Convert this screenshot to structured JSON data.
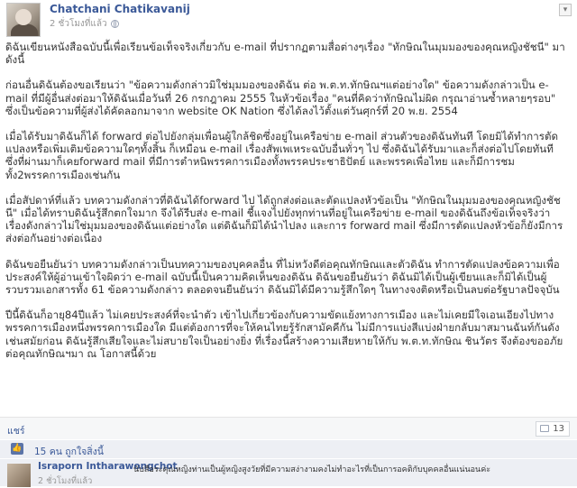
{
  "post": {
    "author": "Chatchani Chatikavanij",
    "time": "2 ชั่วโมงที่แล้ว",
    "paragraphs": [
      "ดิฉันเขียนหนังสือฉบับนี้เพื่อเรียนข้อเท็จจริงเกี่ยวกับ e-mail ที่ปรากฏตามสื่อต่างๆเรื่อง \"ทักษิณในมุมมองของคุณหญิงชัชนี\" มาดังนี้",
      "ก่อนอื่นดิฉันต้องขอเรียนว่า \"ข้อความดังกล่าวมิใช่มุมมองของดิฉัน ต่อ พ.ต.ท.ทักษิณฯแต่อย่างใด\" ข้อความดังกล่าวเป็น e-mail ที่มีผู้อื่นส่งต่อมาให้ดิฉันเมื่อวันที่ 26 กรกฎาคม 2555 ในหัวข้อเรื่อง \"คนที่คิดว่าทักษิณไม่ผิด กรุณาอ่านซ้ำหลายๆรอบ\" ซึ่งเป็นข้อความที่ผู้ส่งได้คัดลอกมาจาก website OK Nation ซึ่งได้ลงไว้ตั้งแต่วันศุกร์ที่ 20 พ.ย. 2554",
      "เมื่อได้รับมาดิฉันก็ได้ forward ต่อไปยังกลุ่มเพื่อนผู้ใกล้ชิดซึ่งอยู่ในเครือข่าย e-mail ส่วนตัวของดิฉันทันที โดยมิได้ทำการตัดแปลงหรือเพิ่มเติมข้อความใดๆทั้งสิ้น ก็เหมือน e-mail เรื่องสัพเพเหระฉบับอื่นทั่วๆ ไป ซึ่งดิฉันได้รับมาและก็ส่งต่อไปโดยทันที ซึ่งที่ผ่านมาก็เคยforward mail ที่มีการตำหนิพรรคการเมืองทั้งพรรคประชาธิปัตย์ และพรรคเพื่อไทย และก็มีการชมทั้ง2พรรคการเมืองเช่นกัน",
      "เมื่อสัปดาห์ที่แล้ว บทความดังกล่าวที่ดิฉันได้forward ไป ได้ถูกส่งต่อและตัดแปลงหัวข้อเป็น \"ทักษิณในมุมมองของคุณหญิงชัชนี\" เมื่อได้ทราบดิฉันรู้สึกตกใจมาก จึงได้รีบส่ง e-mail ชี้แจงไปยังทุกท่านที่อยู่ในเครือข่าย e-mail ของดิฉันถึงข้อเท็จจริงว่า เรื่องดังกล่าวไม่ใช่มุมมองของดิฉันแต่อย่างใด แต่ดิฉันก็มิได้นำไปลง และการ forward mail ซึ่งมีการตัดแปลงหัวข้อก็ยังมีการส่งต่อกันอย่างต่อเนื่อง",
      "ดิฉันขอยืนยันว่า บทความดังกล่าวเป็นบทความของบุคคลอื่น ที่ไม่หวังดีต่อคุณทักษิณและตัวดิฉัน ทำการตัดแปลงข้อความเพื่อประสงค์ให้ผู้อ่านเข้าใจผิดว่า e-mail ฉบับนี้เป็นความคิดเห็นของดิฉัน ดิฉันขอยืนยันว่า ดิฉันมิได้เป็นผู้เขียนและก็มิได้เป็นผู้รวบรวมเอกสารทั้ง 61 ข้อความดังกล่าว ตลอดจนยืนยันว่า ดิฉันมิได้มีความรู้สึกใดๆ ในทางจงติดหรือเป็นลบต่อรัฐบาลปัจจุบัน",
      "ปีนี้ดิฉันก็อายุ84ปีแล้ว ไม่เคยประสงค์ที่จะนำตัว เข้าไปเกี่ยวข้องกับความขัดแย้งทางการเมือง และไม่เคยมีใจเอนเอียงไปทางพรรคการเมืองหนึ่งพรรคการเมืองใด มีแต่ต้องการที่จะให้คนไทยรู้รักสามัคคีกัน ไม่มีการแบ่งสีแบ่งฝ่ายกลับมาสมานฉันท์กันดังเช่นสมัยก่อน ดิฉันรู้สึกเสียใจและไม่สบายใจเป็นอย่างยิ่ง ที่เรื่องนี้สร้างความเสียหายให้กับ พ.ต.ท.ทักษิณ ชินวัตร จึงต้องขออภัยต่อคุณทักษิณฯมา ณ โอกาสนี้ด้วย"
    ]
  },
  "actions": {
    "share_label": "แชร์",
    "share_count": "13"
  },
  "likes": {
    "text": "15 คน ถูกใจสิ่งนี้"
  },
  "comment": {
    "author": "Israporn Intharawongchot",
    "text": "นับสือระคุณหญิงท่านเป็นผู้หญิงสูงวัยที่มีความสง่างามคงไม่ทำอะไรที่เป็นการอคติกับบุคคลอื่นแน่นอนค่ะ",
    "time": "2 ชั่วโมงที่แล้ว"
  },
  "colors": {
    "link": "#3b5998",
    "text": "#333333",
    "muted": "#999999",
    "bar_bg": "#edeff4"
  },
  "icons": [
    "globe-icon",
    "collapse-icon",
    "share-icon",
    "like-icon"
  ]
}
